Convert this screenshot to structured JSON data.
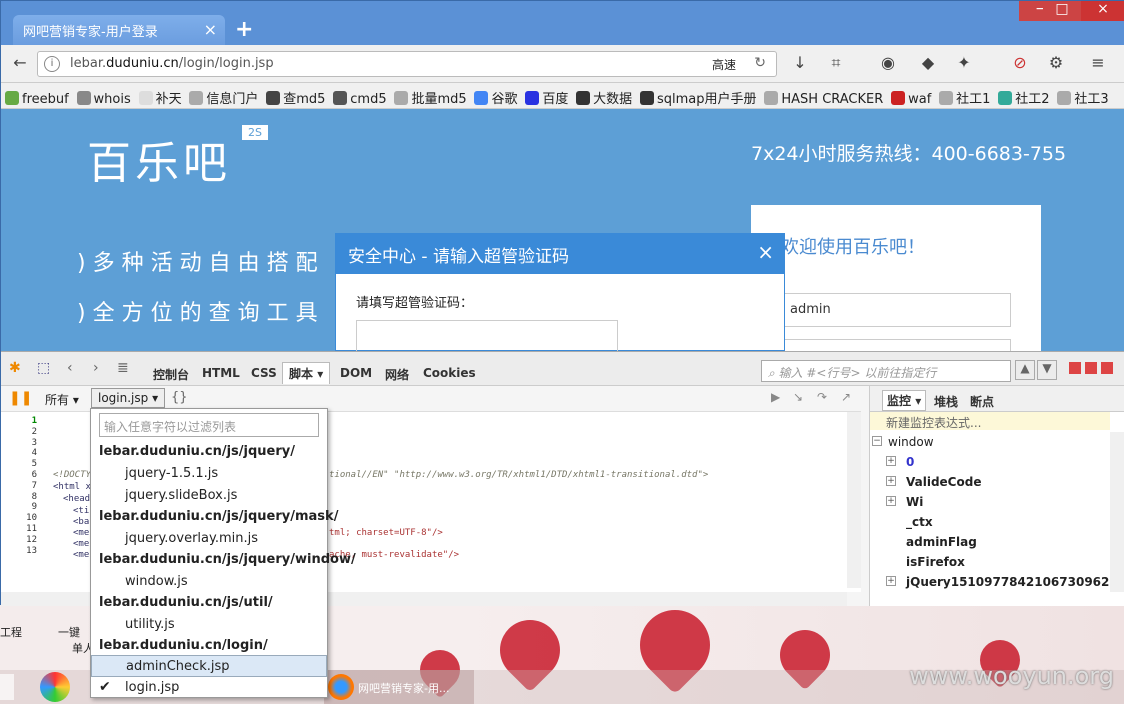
{
  "browser": {
    "tab_title": "网吧营销专家-用户登录",
    "url_prefix": "lebar.",
    "url_domain": "duduniu.cn",
    "url_path": "/login/login.jsp",
    "speed_label": "高速"
  },
  "bookmarks": [
    "freebuf",
    "whois",
    "补天",
    "信息门户",
    "查md5",
    "cmd5",
    "批量md5",
    "谷歌",
    "百度",
    "大数据",
    "sqlmap用户手册",
    "HASH CRACKER",
    "waf",
    "社工1",
    "社工2",
    "社工3"
  ],
  "page": {
    "logo": "百乐吧",
    "logo_badge": "2S",
    "hotline": "7x24小时服务热线：400-6683-755",
    "slogans": [
      ")多种活动自由搭配",
      ")全方位的查询工具"
    ],
    "welcome": "欢迎使用百乐吧！",
    "username_value": "admin"
  },
  "dialog": {
    "title": "安全中心 - 请输入超管验证码",
    "label": "请填写超管验证码："
  },
  "devtools": {
    "tabs": [
      "控制台",
      "HTML",
      "CSS",
      "脚本",
      "DOM",
      "网络",
      "Cookies"
    ],
    "active_tab": "脚本",
    "search_placeholder": "输入 #<行号> 以前往指定行",
    "filter_all": "所有",
    "current_file": "login.jsp",
    "line_numbers": [
      "1",
      "2",
      "3",
      "4",
      "5",
      "6",
      "7",
      "8",
      "9",
      "10",
      "11",
      "12",
      "13"
    ],
    "code_line_6_right": "tional//EN\" \"http://www.w3.org/TR/xhtml1/DTD/xhtml1-transitional.dtd\">",
    "code_line_6_left": "<!DOCTY",
    "code_line_7": "<html x",
    "code_line_8": "<head",
    "code_line_9": "<ti",
    "code_line_10": "<ba",
    "code_line_11": "<me",
    "code_line_11_right": "tml; charset=UTF-8\"/>",
    "code_line_12": "<me",
    "code_line_13": "<me",
    "code_line_13_right": "ache, must-revalidate\"/>",
    "watch_tabs": [
      "监控",
      "堆栈",
      "断点"
    ],
    "watch_new": "新建监控表达式...",
    "watch_rows": [
      {
        "name": "window",
        "expand": "−"
      },
      {
        "name": "0",
        "expand": "+"
      },
      {
        "name": "ValideCode",
        "expand": "+"
      },
      {
        "name": "Wi",
        "expand": "+"
      },
      {
        "name": "_ctx",
        "expand": ""
      },
      {
        "name": "adminFlag",
        "expand": ""
      },
      {
        "name": "isFirefox",
        "expand": ""
      },
      {
        "name": "jQuery1510977842106730962",
        "expand": "+"
      }
    ]
  },
  "dropdown": {
    "filter_placeholder": "输入任意字符以过滤列表",
    "items": [
      {
        "text": "lebar.duduniu.cn/js/jquery/",
        "kind": "group"
      },
      {
        "text": "jquery-1.5.1.js",
        "kind": "file"
      },
      {
        "text": "jquery.slideBox.js",
        "kind": "file"
      },
      {
        "text": "lebar.duduniu.cn/js/jquery/mask/",
        "kind": "group"
      },
      {
        "text": "jquery.overlay.min.js",
        "kind": "file"
      },
      {
        "text": "lebar.duduniu.cn/js/jquery/window/",
        "kind": "group"
      },
      {
        "text": "window.js",
        "kind": "file"
      },
      {
        "text": "lebar.duduniu.cn/js/util/",
        "kind": "group"
      },
      {
        "text": "utility.js",
        "kind": "file"
      },
      {
        "text": "lebar.duduniu.cn/login/",
        "kind": "group"
      },
      {
        "text": "adminCheck.jsp",
        "kind": "file-hl"
      },
      {
        "text": "login.jsp",
        "kind": "file-checked"
      }
    ]
  },
  "desktop": {
    "taskbar_item": "网吧营销专家-用...",
    "icon_labels": [
      "工程",
      "一键",
      "单人"
    ],
    "watermark": "www.wooyun.org"
  },
  "colors": {
    "page_bg": "#5d9fd6",
    "dialog_head": "#3a8ad8",
    "heart": "#c81a2a"
  }
}
